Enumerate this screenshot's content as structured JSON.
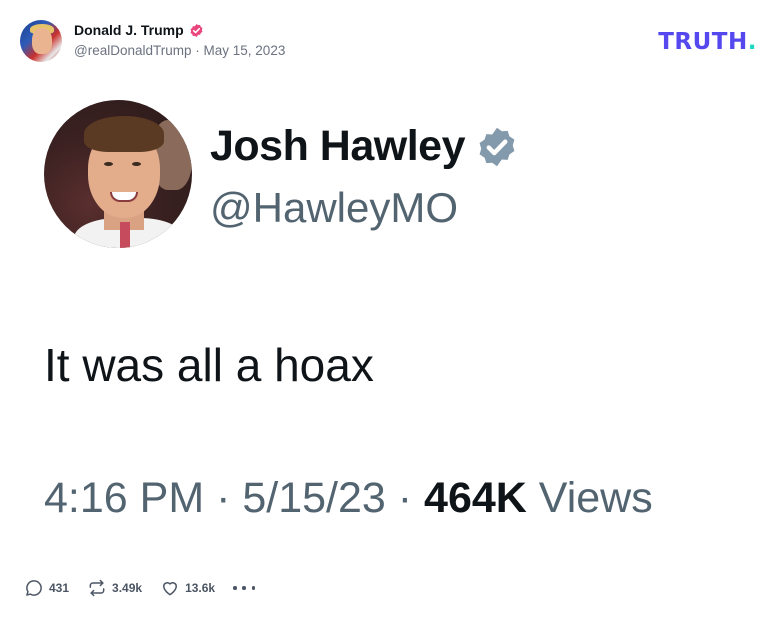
{
  "post": {
    "author_name": "Donald J. Trump",
    "handle": "@realDonaldTrump",
    "separator": "·",
    "date": "May 15, 2023"
  },
  "logo": {
    "text": "TRUTH",
    "dot": "."
  },
  "tweet": {
    "name": "Josh Hawley",
    "handle": "@HawleyMO",
    "text": "It was all a hoax",
    "time": "4:16 PM",
    "sep1": " · ",
    "date": "5/15/23",
    "sep2": " · ",
    "views_count": "464K",
    "views_label": " Views"
  },
  "actions": {
    "replies": "431",
    "retruths": "3.49k",
    "likes": "13.6k"
  },
  "icons": [
    "verified-badge-icon",
    "reply-icon",
    "retruth-icon",
    "heart-icon",
    "more-icon"
  ],
  "colors": {
    "truth_purple": "#5448ee",
    "truth_teal": "#1ed6c3",
    "verified_pink": "#e8467c",
    "twitter_verified_gray": "#829aab"
  }
}
